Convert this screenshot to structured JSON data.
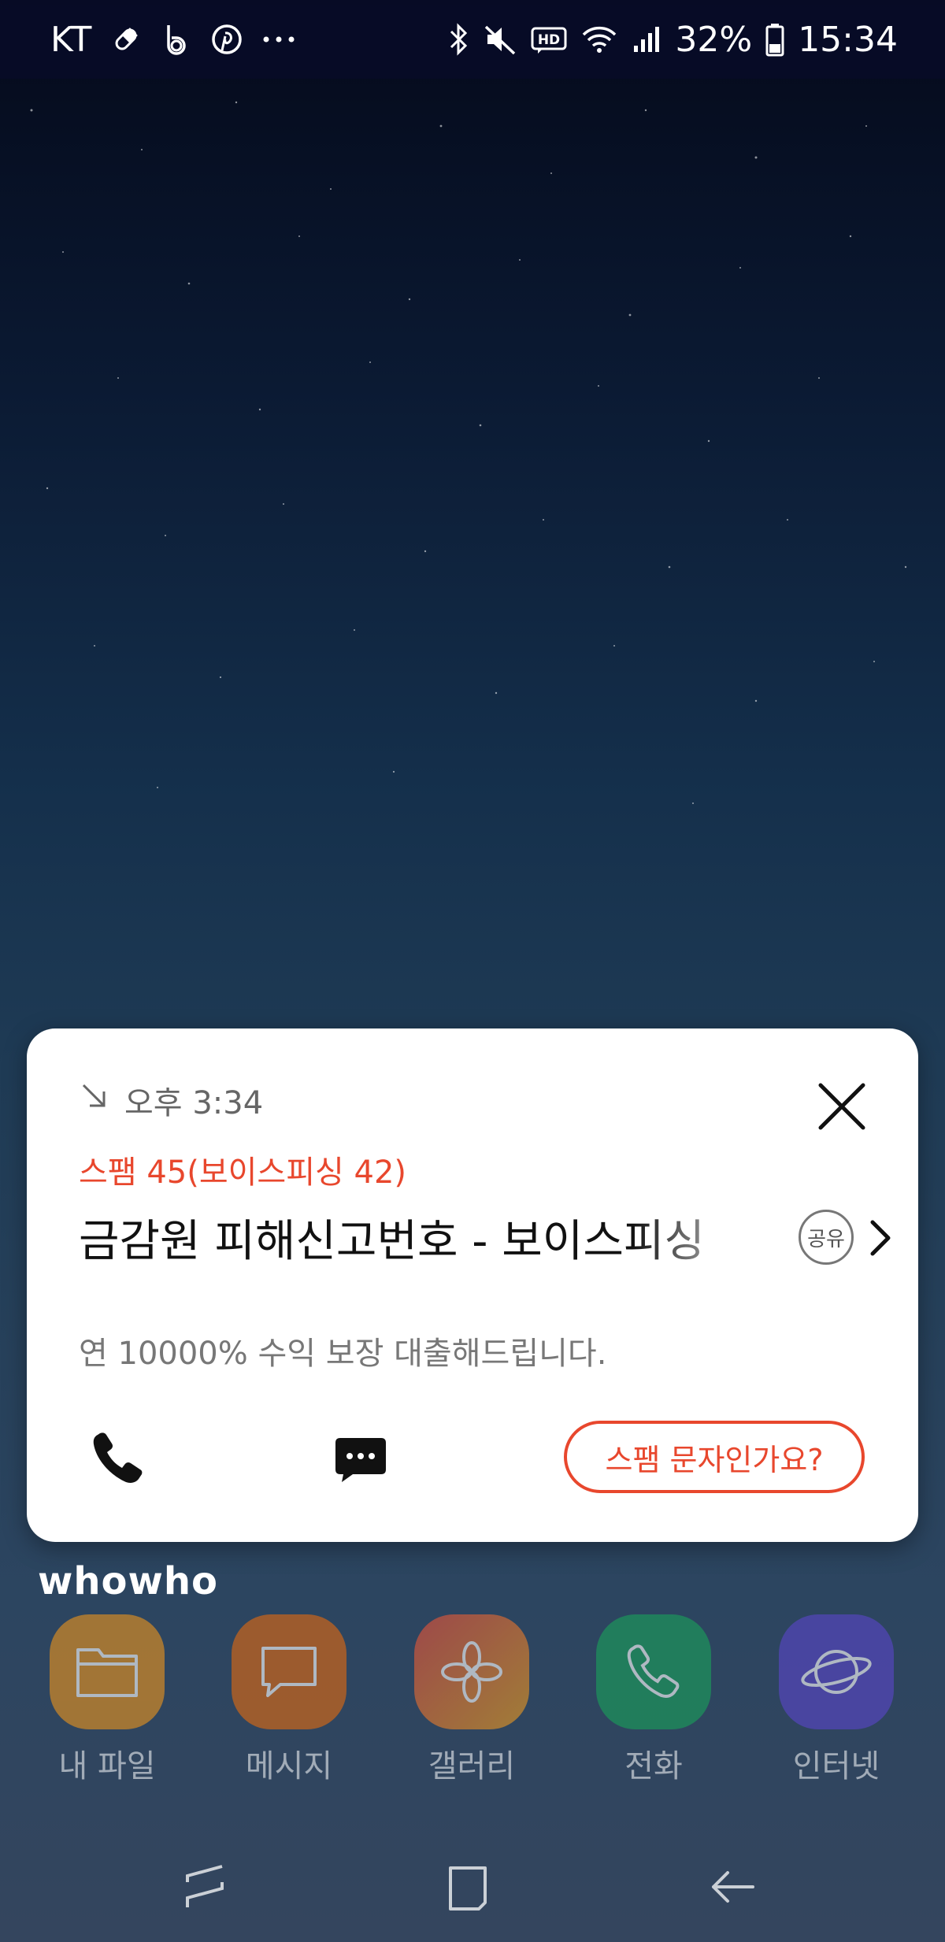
{
  "status_bar": {
    "carrier": "KT",
    "battery": "32%",
    "time": "15:34"
  },
  "popup": {
    "call_time": "오후 3:34",
    "spam_label": "스팸 45(보이스피싱 42)",
    "title": "금감원 피해신고번호 - 보이스피싱",
    "share_badge": "공유",
    "message": "연 10000% 수익 보장 대출해드립니다.",
    "spam_ask_button": "스팸 문자인가요?",
    "colors": {
      "accent": "#e8472d"
    }
  },
  "logo": "whowho",
  "dock": {
    "apps": [
      {
        "label": "내 파일",
        "icon": "folder-icon",
        "color": "#e9931d"
      },
      {
        "label": "메시지",
        "icon": "message-icon",
        "color": "#e06a10"
      },
      {
        "label": "갤러리",
        "icon": "flower-icon",
        "color": "#e46a2c"
      },
      {
        "label": "전화",
        "icon": "phone-icon",
        "color": "#1aa05a"
      },
      {
        "label": "인터넷",
        "icon": "planet-icon",
        "color": "#5a46c8"
      }
    ]
  },
  "nav_bar": {
    "buttons": [
      "recent-apps-icon",
      "home-icon",
      "back-icon"
    ]
  }
}
